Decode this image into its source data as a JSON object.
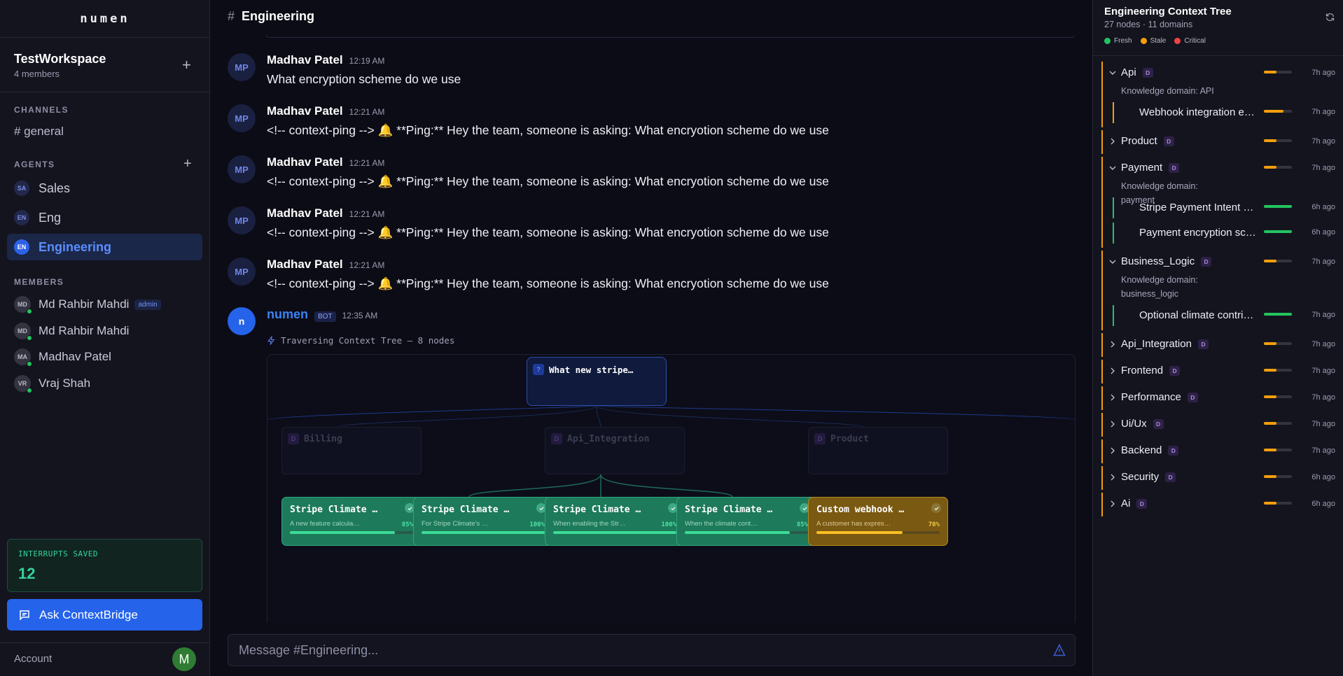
{
  "brand": "numen",
  "workspace": {
    "name": "TestWorkspace",
    "members": "4 members"
  },
  "sidebar": {
    "channels_title": "CHANNELS",
    "channel": "# general",
    "agents_title": "AGENTS",
    "agents": [
      {
        "initials": "SA",
        "name": "Sales",
        "active": false
      },
      {
        "initials": "EN",
        "name": "Eng",
        "active": false
      },
      {
        "initials": "EN",
        "name": "Engineering",
        "active": true
      }
    ],
    "members_title": "MEMBERS",
    "members": [
      {
        "initials": "MD",
        "name": "Md Rahbir Mahdi",
        "badge": "admin"
      },
      {
        "initials": "MD",
        "name": "Md Rahbir Mahdi"
      },
      {
        "initials": "MA",
        "name": "Madhav Patel"
      },
      {
        "initials": "VR",
        "name": "Vraj Shah"
      }
    ],
    "interrupts_label": "INTERRUPTS SAVED",
    "interrupts_value": "12",
    "ask_button": "Ask ContextBridge",
    "account_label": "Account",
    "account_initial": "M"
  },
  "channel": {
    "name": "Engineering",
    "composer_placeholder": "Message #Engineering..."
  },
  "messages": [
    {
      "initials": "MP",
      "name": "Madhav Patel",
      "time": "12:19 AM",
      "text": "What encryption scheme do we use"
    },
    {
      "initials": "MP",
      "name": "Madhav Patel",
      "time": "12:21 AM",
      "text": "<!-- context-ping --> 🔔 **Ping:** Hey the team, someone is asking: What encryotion scheme do we use"
    },
    {
      "initials": "MP",
      "name": "Madhav Patel",
      "time": "12:21 AM",
      "text": "<!-- context-ping --> 🔔 **Ping:** Hey the team, someone is asking: What encryotion scheme do we use"
    },
    {
      "initials": "MP",
      "name": "Madhav Patel",
      "time": "12:21 AM",
      "text": "<!-- context-ping --> 🔔 **Ping:** Hey the team, someone is asking: What encryotion scheme do we use"
    },
    {
      "initials": "MP",
      "name": "Madhav Patel",
      "time": "12:21 AM",
      "text": "<!-- context-ping --> 🔔 **Ping:** Hey the team, someone is asking: What encryotion scheme do we use"
    }
  ],
  "bot": {
    "initial": "n",
    "name": "numen",
    "badge": "BOT",
    "time": "12:35 AM",
    "traverse": "Traversing Context Tree — 8 nodes",
    "query_icon": "?",
    "query_node": "What new stripe…",
    "domains": [
      {
        "icon": "D",
        "label": "Billing"
      },
      {
        "icon": "D",
        "label": "Api_Integration"
      },
      {
        "icon": "D",
        "label": "Product"
      }
    ],
    "leaves": [
      {
        "title": "Stripe Climate …",
        "desc": "A new feature calcula…",
        "pct": "85%",
        "progress": 0.85,
        "status": "fresh"
      },
      {
        "title": "Stripe Climate …",
        "desc": "For Stripe Climate's …",
        "pct": "100%",
        "progress": 1.0,
        "status": "fresh"
      },
      {
        "title": "Stripe Climate …",
        "desc": "When enabling the Str…",
        "pct": "100%",
        "progress": 1.0,
        "status": "fresh"
      },
      {
        "title": "Stripe Climate …",
        "desc": "When the climate cont…",
        "pct": "85%",
        "progress": 0.85,
        "status": "fresh"
      },
      {
        "title": "Custom webhook …",
        "desc": "A customer has expres…",
        "pct": "70%",
        "progress": 0.7,
        "status": "stale"
      }
    ]
  },
  "context_tree": {
    "title": "Engineering Context Tree",
    "subtitle": "27 nodes · 11 domains",
    "legend": [
      {
        "label": "Fresh",
        "color": "#22c55e"
      },
      {
        "label": "Stale",
        "color": "#f59e0b"
      },
      {
        "label": "Critical",
        "color": "#ef4444"
      }
    ],
    "nodes": [
      {
        "name": "Api",
        "badge": "D",
        "ago": "7h ago",
        "expanded": true,
        "desc": "Knowledge domain: API",
        "freshness": 0.45,
        "children": [
          {
            "name": "Webhook integration e…",
            "ago": "7h ago",
            "freshness": 0.7,
            "status": "stale"
          }
        ]
      },
      {
        "name": "Product",
        "badge": "D",
        "ago": "7h ago",
        "expanded": false,
        "freshness": 0.45
      },
      {
        "name": "Payment",
        "badge": "D",
        "ago": "7h ago",
        "expanded": true,
        "desc": "Knowledge domain: payment",
        "freshness": 0.45,
        "children": [
          {
            "name": "Stripe Payment Intent …",
            "ago": "6h ago",
            "freshness": 1.0,
            "status": "fresh"
          },
          {
            "name": "Payment encryption sc…",
            "ago": "6h ago",
            "freshness": 1.0,
            "status": "fresh"
          }
        ]
      },
      {
        "name": "Business_Logic",
        "badge": "D",
        "ago": "7h ago",
        "expanded": true,
        "desc": "Knowledge domain: business_logic",
        "freshness": 0.45,
        "children": [
          {
            "name": "Optional climate contri…",
            "ago": "7h ago",
            "freshness": 1.0,
            "status": "fresh"
          }
        ]
      },
      {
        "name": "Api_Integration",
        "badge": "D",
        "ago": "7h ago",
        "expanded": false,
        "freshness": 0.45
      },
      {
        "name": "Frontend",
        "badge": "D",
        "ago": "7h ago",
        "expanded": false,
        "freshness": 0.45
      },
      {
        "name": "Performance",
        "badge": "D",
        "ago": "7h ago",
        "expanded": false,
        "freshness": 0.45
      },
      {
        "name": "Ui/Ux",
        "badge": "D",
        "ago": "7h ago",
        "expanded": false,
        "freshness": 0.45
      },
      {
        "name": "Backend",
        "badge": "D",
        "ago": "7h ago",
        "expanded": false,
        "freshness": 0.45
      },
      {
        "name": "Security",
        "badge": "D",
        "ago": "6h ago",
        "expanded": false,
        "freshness": 0.45
      },
      {
        "name": "Ai",
        "badge": "D",
        "ago": "6h ago",
        "expanded": false,
        "freshness": 0.45
      }
    ]
  }
}
